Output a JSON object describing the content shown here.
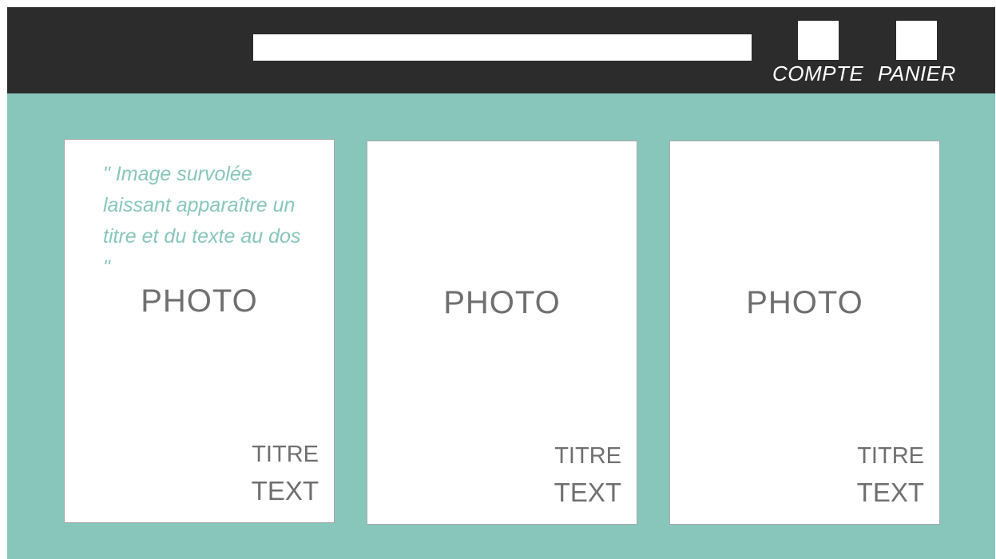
{
  "header": {
    "search": {
      "value": "",
      "placeholder": ""
    },
    "account": {
      "label": "COMPTE",
      "icon": "account-icon"
    },
    "cart": {
      "label": "PANIER",
      "icon": "cart-icon"
    }
  },
  "cards": [
    {
      "hover_note": "\" Image survolée laissant apparaître un titre et du texte au dos \"",
      "photo": "PHOTO",
      "title": "TITRE",
      "text": "TEXT"
    },
    {
      "photo": "PHOTO",
      "title": "TITRE",
      "text": "TEXT"
    },
    {
      "photo": "PHOTO",
      "title": "TITRE",
      "text": "TEXT"
    }
  ],
  "colors": {
    "header_bg": "#2c2c2c",
    "page_bg": "#88c6bb",
    "card_bg": "#ffffff",
    "accent_text": "#88c6bb",
    "placeholder_text": "#6f6f6f"
  }
}
